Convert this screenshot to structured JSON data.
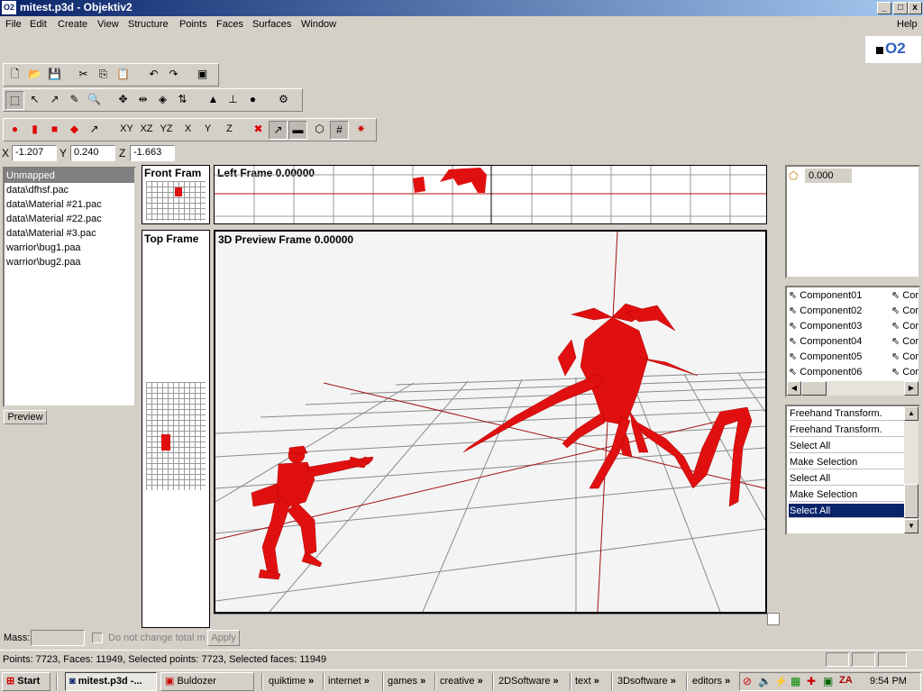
{
  "window": {
    "title": "mitest.p3d - Objektiv2",
    "minimize_label": "_",
    "close_label": "x"
  },
  "menu": {
    "items": [
      "File",
      "Edit",
      "Create",
      "View",
      "Structure",
      "Points",
      "Faces",
      "Surfaces",
      "Window"
    ],
    "help": "Help"
  },
  "logo": {
    "text": "O2"
  },
  "toolbar": {
    "view_buttons": [
      "XY",
      "XZ",
      "YZ",
      "X",
      "Y",
      "Z"
    ]
  },
  "coords": {
    "x_label": "X",
    "x_value": "-1.207",
    "y_label": "Y",
    "y_value": "0.240",
    "z_label": "Z",
    "z_value": "-1.663"
  },
  "textures": {
    "items": [
      "Unmapped",
      "data\\dfhsf.pac",
      "data\\Material #21.pac",
      "data\\Material #22.pac",
      "data\\Material #3.pac",
      "warrior\\bug1.paa",
      "warrior\\bug2.paa"
    ],
    "preview_button": "Preview"
  },
  "frames": {
    "front": "Front Fram",
    "left": "Left Frame 0.00000",
    "top": "Top Frame",
    "preview": "3D Preview Frame 0.00000"
  },
  "lod": {
    "value": "0.000"
  },
  "components": {
    "items": [
      "Component01",
      "Component02",
      "Component03",
      "Component04",
      "Component05",
      "Component06"
    ],
    "col2_prefix": "Cor"
  },
  "selections": {
    "items": [
      "Freehand Transform.",
      "Freehand Transform.",
      "Select All",
      "Make Selection",
      "Select All",
      "Make Selection",
      "Select All"
    ],
    "active_index": 6
  },
  "mass": {
    "label": "Mass:",
    "value": "",
    "checkbox_label": "Do not change total ma",
    "apply_button": "Apply"
  },
  "status": {
    "text": "Points: 7723, Faces: 11949, Selected points: 7723, Selected faces: 11949"
  },
  "taskbar": {
    "start": "Start",
    "tasks": [
      "mitest.p3d -...",
      "Buldozer"
    ],
    "quick": [
      "quiktime",
      "internet",
      "games",
      "creative",
      "2DSoftware",
      "text",
      "3Dsoftware",
      "editors"
    ],
    "arrow": "»",
    "clock": "9:54 PM"
  },
  "colors": {
    "model": "#e01010",
    "selection": "#0a246a",
    "titlebar": "#0a246a"
  }
}
